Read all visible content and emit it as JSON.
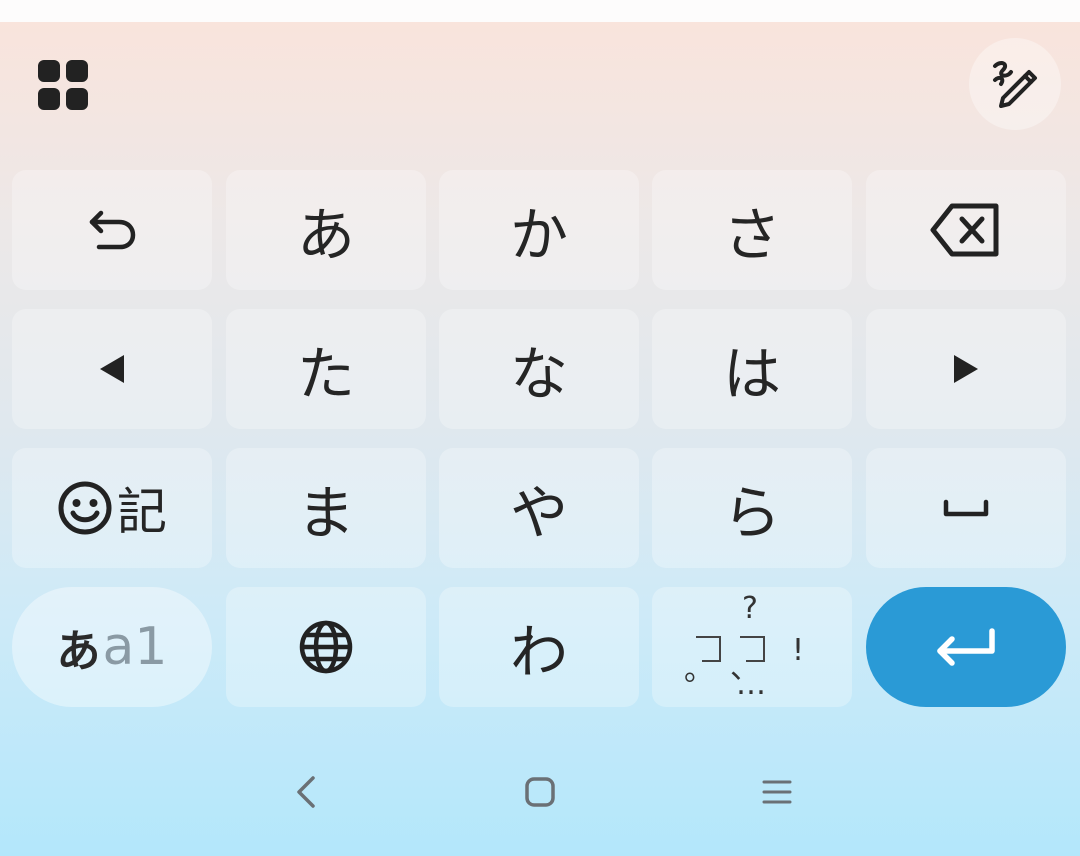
{
  "keyboard": {
    "colors": {
      "accent": "#2a9ad6",
      "key_text": "#252525",
      "mode_dim": "#8a9aa4"
    },
    "toolbar": {
      "apps_icon": "grid-icon",
      "handwriting_icon": "handwriting-pen-icon"
    },
    "keys": {
      "undo": "undo-icon",
      "a": "あ",
      "ka": "か",
      "sa": "さ",
      "backspace": "backspace-icon",
      "left": "arrow-left-icon",
      "ta": "た",
      "na": "な",
      "ha": "は",
      "right": "arrow-right-icon",
      "symbols": "記",
      "ma": "ま",
      "ya": "や",
      "ra": "ら",
      "space": "space-icon",
      "mode_kana": "あ",
      "mode_alpha": "a1",
      "globe": "globe-icon",
      "wa": "わ",
      "punct_question": "?",
      "punct_maru": "。",
      "punct_ten": "、",
      "punct_exclaim": "!",
      "punct_ellipsis": "…",
      "enter": "enter-icon"
    }
  },
  "navbar": {
    "back": "back-icon",
    "home": "home-icon",
    "recents": "recents-icon"
  }
}
